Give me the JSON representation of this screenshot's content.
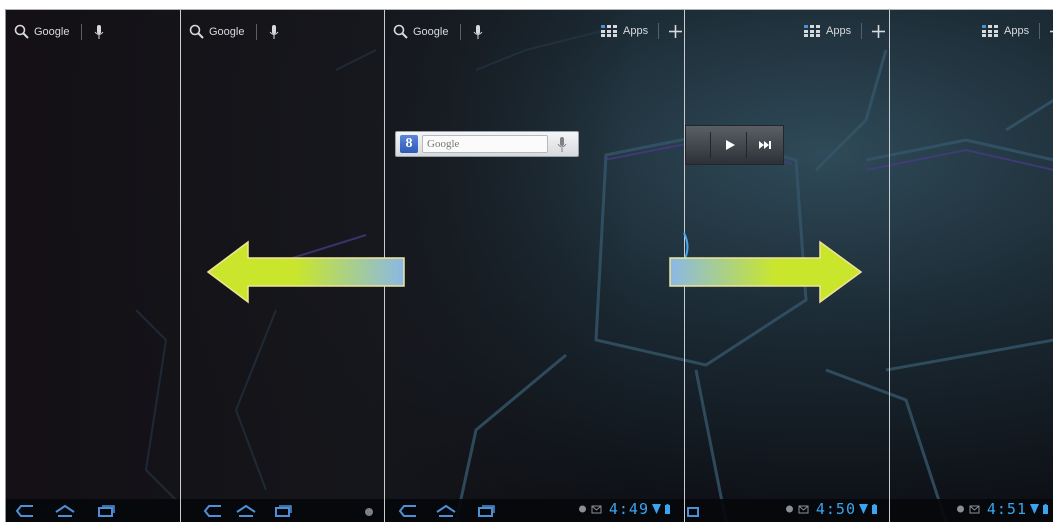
{
  "search_bars": [
    {
      "label": "Google"
    },
    {
      "label": "Google"
    },
    {
      "label": "Google"
    }
  ],
  "apps_buttons": [
    {
      "label": "Apps"
    },
    {
      "label": "Apps"
    },
    {
      "label": "Apps"
    }
  ],
  "google_widget": {
    "placeholder": "Google",
    "logo": "8"
  },
  "clocks": [
    "4:49",
    "4:50",
    "4:51"
  ],
  "arrows": {
    "left": "swipe-left-arrow",
    "right": "swipe-right-arrow"
  },
  "colors": {
    "arrow_green": "#c9e62d",
    "arrow_blue": "#8ab8e6",
    "clock_blue": "#3aa4f0",
    "accent_purple": "#5a3f9a"
  }
}
